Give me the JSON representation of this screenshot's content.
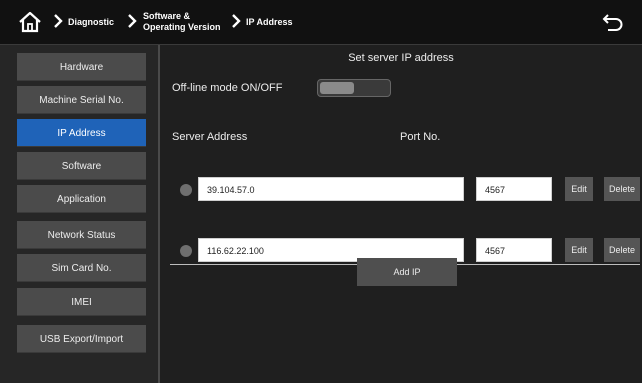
{
  "header": {
    "breadcrumbs": [
      "Diagnostic",
      "Software &",
      "Operating Version",
      "IP Address"
    ],
    "home_icon": "home-icon",
    "back_icon": "back-arrow-icon"
  },
  "sidebar": {
    "items": [
      {
        "label": "Hardware",
        "active": false
      },
      {
        "label": "Machine Serial No.",
        "active": false
      },
      {
        "label": "IP Address",
        "active": true
      },
      {
        "label": "Software",
        "active": false
      },
      {
        "label": "Application",
        "active": false
      },
      {
        "label": "Network Status",
        "active": false
      },
      {
        "label": "Sim Card No.",
        "active": false
      },
      {
        "label": "IMEI",
        "active": false
      },
      {
        "label": "USB Export/Import",
        "active": false
      }
    ]
  },
  "main": {
    "title": "Set server IP address",
    "offline_label": "Off-line mode ON/OFF",
    "offline_on": false,
    "server_address_label": "Server Address",
    "port_label": "Port No.",
    "servers": [
      {
        "address": "39.104.57.0",
        "port": "4567",
        "edit": "Edit",
        "delete": "Delete"
      },
      {
        "address": "116.62.22.100",
        "port": "4567",
        "edit": "Edit",
        "delete": "Delete"
      }
    ],
    "add_label": "Add IP"
  },
  "colors": {
    "active": "#1f63b8",
    "background": "#1f1f1f",
    "button": "#4b4b4b"
  }
}
